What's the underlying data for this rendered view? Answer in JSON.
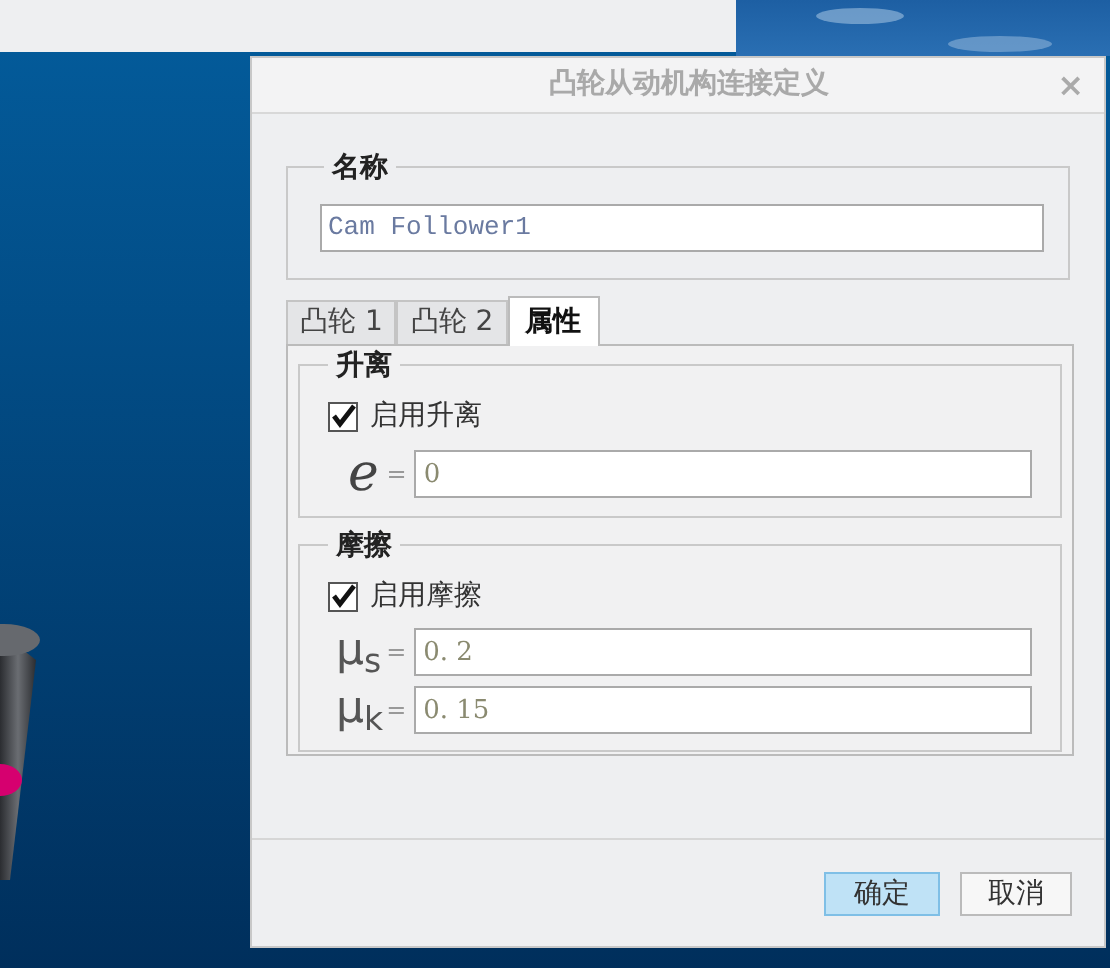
{
  "window": {
    "title": "凸轮从动机构连接定义",
    "close": "×"
  },
  "name_group": {
    "label": "名称",
    "value": "Cam Follower1"
  },
  "tabs": [
    {
      "label": "凸轮 1",
      "selected": false
    },
    {
      "label": "凸轮 2",
      "selected": false
    },
    {
      "label": "属性",
      "selected": true
    }
  ],
  "groups": [
    {
      "label": "升离",
      "checkbox": {
        "label": "启用升离",
        "checked": true
      },
      "fields": [
        {
          "kind": "italic",
          "symbol": "e",
          "equals": "=",
          "value": "0"
        }
      ]
    },
    {
      "label": "摩擦",
      "checkbox": {
        "label": "启用摩擦",
        "checked": true
      },
      "fields": [
        {
          "kind": "sub",
          "symbol": "μ$_{s}$",
          "equals": "=",
          "value": "0. 2"
        },
        {
          "kind": "sub",
          "symbol": "μ$_{k}$",
          "equals": "=",
          "value": "0. 15"
        }
      ]
    }
  ],
  "buttons": [
    {
      "label": "确定",
      "default": true
    },
    {
      "label": "取消",
      "default": false
    }
  ]
}
